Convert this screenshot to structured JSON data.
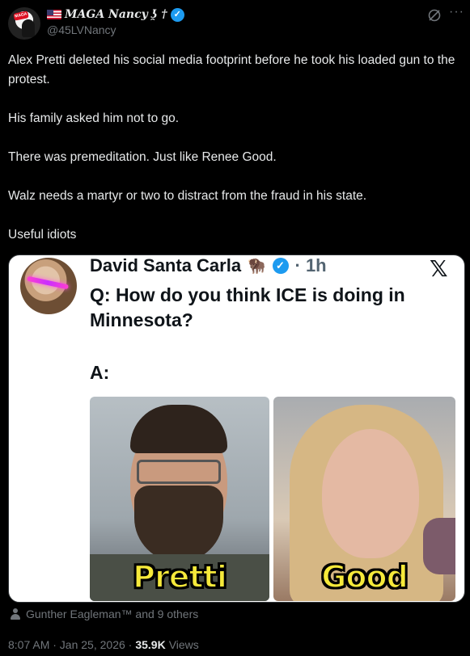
{
  "author": {
    "display_name": "MAGA Nancy",
    "name_suffix": "ʖ̯ †",
    "handle": "@45LVNancy",
    "avatar_badge": "MAGA"
  },
  "tweet": {
    "paragraphs": [
      "Alex Pretti deleted his social media footprint before he took his loaded gun to the protest.",
      "His family asked him not to go.",
      "There was premeditation. Just like Renee Good.",
      "Walz needs a martyr or two to distract from the fraud in his state.",
      "Useful idiots"
    ]
  },
  "media": {
    "quoted_name": "David Santa Carla",
    "quoted_time": "· 1h",
    "question": "Q: How do you think ICE is doing in Minnesota?",
    "answer": "A:",
    "captions": [
      "Pretti",
      "Good"
    ]
  },
  "tagged": "Gunther Eagleman™ and 9 others",
  "meta": {
    "timestamp": "8:07 AM · Jan 25, 2026 ·",
    "views_count": "35.9K",
    "views_label": "Views"
  },
  "colors": {
    "background": "#000000",
    "verified": "#1d9bf0",
    "muted": "#71767b",
    "caption": "#f6e93a"
  },
  "icons": [
    "verified-badge-icon",
    "grok-icon",
    "more-icon",
    "x-logo-icon",
    "person-icon"
  ]
}
